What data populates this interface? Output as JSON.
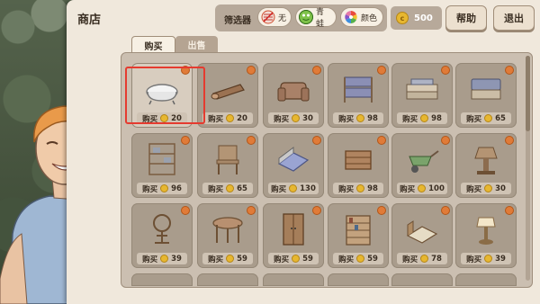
{
  "window": {
    "title": "商店"
  },
  "filters": {
    "label": "筛选器",
    "chips": [
      {
        "label": "无",
        "icon": "no-filter-icon"
      },
      {
        "label": "青蛙",
        "icon": "frog-icon"
      },
      {
        "label": "颜色",
        "icon": "color-wheel-icon"
      }
    ]
  },
  "wallet": {
    "coins": "500"
  },
  "buttons": {
    "help": "帮助",
    "exit": "退出"
  },
  "tabs": [
    {
      "label": "购买"
    },
    {
      "label": "出售"
    }
  ],
  "buy_label": "购买",
  "items": [
    {
      "name": "bathtub",
      "price": "20"
    },
    {
      "name": "log-stool",
      "price": "20"
    },
    {
      "name": "armchair",
      "price": "30"
    },
    {
      "name": "bunk-bed",
      "price": "98"
    },
    {
      "name": "pallet-table",
      "price": "98"
    },
    {
      "name": "pallet-sofa",
      "price": "65"
    },
    {
      "name": "crate-shelf",
      "price": "96"
    },
    {
      "name": "wooden-chair",
      "price": "65"
    },
    {
      "name": "blue-bed",
      "price": "130"
    },
    {
      "name": "wooden-crate",
      "price": "98"
    },
    {
      "name": "wheelbarrow",
      "price": "100"
    },
    {
      "name": "lantern-stand",
      "price": "30"
    },
    {
      "name": "spinning-wheel",
      "price": "39"
    },
    {
      "name": "round-table",
      "price": "59"
    },
    {
      "name": "wardrobe",
      "price": "59"
    },
    {
      "name": "bookshelf",
      "price": "59"
    },
    {
      "name": "wooden-bed",
      "price": "78"
    },
    {
      "name": "table-lamp",
      "price": "39"
    }
  ],
  "colors": {
    "panel": "#f0e8dc",
    "item": "#a99c8c",
    "badge": "#e07b38",
    "selector": "#e53b2f",
    "coin": "#e7b730"
  }
}
